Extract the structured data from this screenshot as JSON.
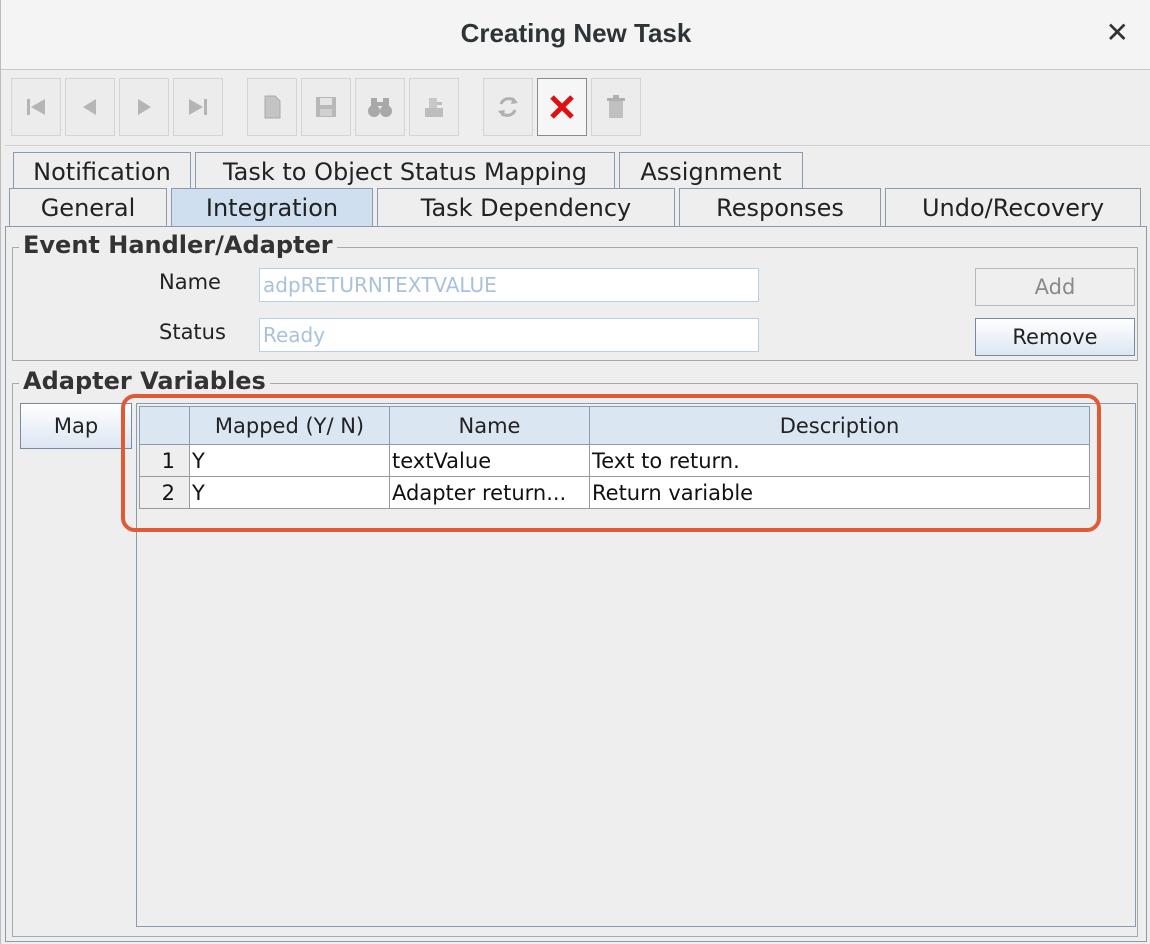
{
  "window": {
    "title": "Creating New Task"
  },
  "toolbar": {
    "buttons": [
      {
        "name": "first-record-icon",
        "enabled": false
      },
      {
        "name": "previous-record-icon",
        "enabled": false
      },
      {
        "name": "next-record-icon",
        "enabled": false
      },
      {
        "name": "last-record-icon",
        "enabled": false
      },
      {
        "name": "new-document-icon",
        "enabled": false
      },
      {
        "name": "save-icon",
        "enabled": false
      },
      {
        "name": "find-binoculars-icon",
        "enabled": false
      },
      {
        "name": "query-icon",
        "enabled": false
      },
      {
        "name": "refresh-icon",
        "enabled": false
      },
      {
        "name": "cancel-red-x-icon",
        "enabled": true
      },
      {
        "name": "delete-trash-icon",
        "enabled": false
      }
    ]
  },
  "tabs": {
    "top_row": [
      "Notification",
      "Task to Object Status Mapping",
      "Assignment"
    ],
    "bottom_row": [
      "General",
      "Integration",
      "Task Dependency",
      "Responses",
      "Undo/Recovery"
    ],
    "selected": "Integration"
  },
  "event_handler": {
    "title": "Event Handler/Adapter",
    "name_label": "Name",
    "name_value": "adpRETURNTEXTVALUE",
    "status_label": "Status",
    "status_value": "Ready",
    "add_label": "Add",
    "remove_label": "Remove"
  },
  "adapter_variables": {
    "title": "Adapter Variables",
    "map_label": "Map",
    "columns": [
      "",
      "Mapped (Y/ N)",
      "Name",
      "Description"
    ],
    "rows": [
      {
        "num": "1",
        "mapped": "Y",
        "name": "textValue",
        "description": "Text to return."
      },
      {
        "num": "2",
        "mapped": "Y",
        "name": "Adapter return...",
        "description": "Return variable"
      }
    ]
  },
  "colors": {
    "highlight": "#e05a35",
    "selected_tab": "#cfdff0",
    "table_header": "#dbe6f3"
  }
}
